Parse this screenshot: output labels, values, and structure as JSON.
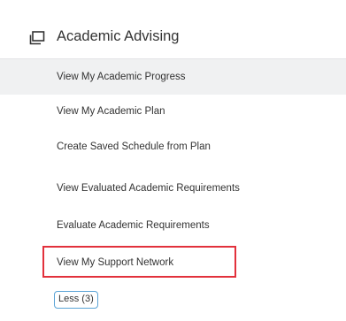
{
  "section": {
    "title": "Academic Advising",
    "icon": "window-stack-icon"
  },
  "menu_items": [
    {
      "label": "View My Academic Progress",
      "active": true
    },
    {
      "label": "View My Academic Plan",
      "active": false
    },
    {
      "label": "Create Saved Schedule from Plan",
      "active": false
    },
    {
      "label": "View Evaluated Academic Requirements",
      "active": false
    },
    {
      "label": "Evaluate Academic Requirements",
      "active": false
    },
    {
      "label": "View My Support Network",
      "active": false,
      "highlighted": true
    }
  ],
  "less_button": {
    "label": "Less (3)"
  },
  "colors": {
    "highlight_border": "#e2313c",
    "active_row_bg": "#f0f1f2",
    "less_button_border": "#5aa3d6"
  }
}
